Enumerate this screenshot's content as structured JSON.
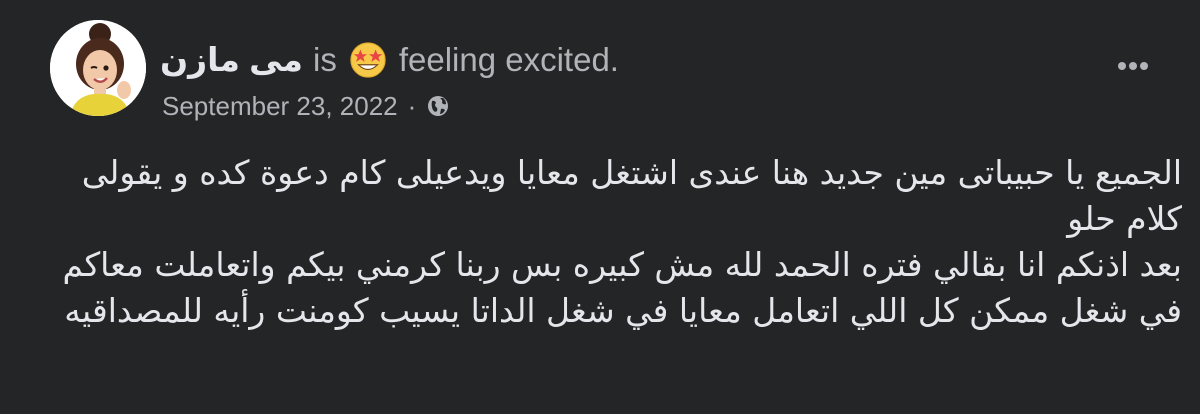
{
  "post": {
    "author": "مى مازن",
    "is_word": "is",
    "activity_emoji": "star-struck-emoji",
    "activity_text": "feeling excited.",
    "date": "September 23, 2022",
    "separator": "·",
    "audience_icon": "globe-icon",
    "more_icon": "more-options-icon",
    "body_lines": [
      "الجميع يا حبيباتى مين جديد هنا عندى اشتغل معايا ويدعيلى كام دعوة كده و يقولى كلام حلو",
      "بعد اذنكم انا بقالي فتره الحمد لله مش كبيره بس ربنا كرمني بيكم واتعاملت معاكم في شغل ممكن كل اللي اتعامل معايا في شغل الداتا يسيب كومنت رأيه للمصداقيه"
    ]
  },
  "colors": {
    "background": "#242526",
    "primary_text": "#e4e6eb",
    "secondary_text": "#b0b3b8"
  }
}
